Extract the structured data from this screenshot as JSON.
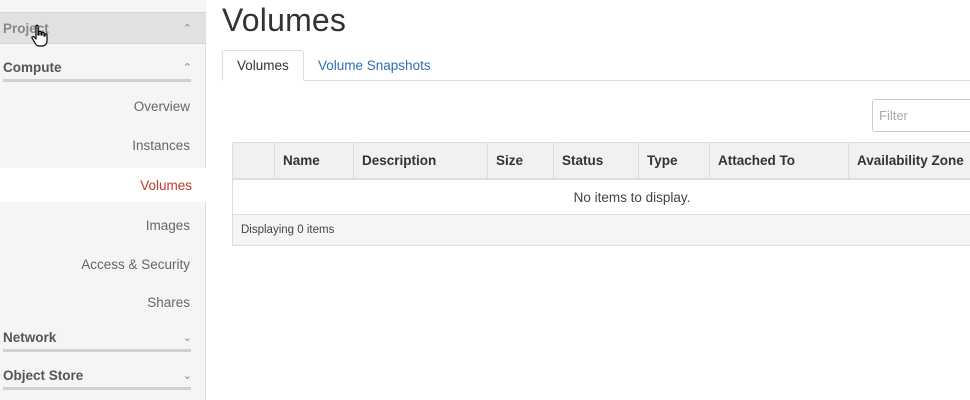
{
  "sidebar": {
    "project": {
      "label": "Project"
    },
    "compute": {
      "label": "Compute",
      "items": [
        {
          "label": "Overview"
        },
        {
          "label": "Instances"
        },
        {
          "label": "Volumes"
        },
        {
          "label": "Images"
        },
        {
          "label": "Access & Security"
        },
        {
          "label": "Shares"
        }
      ]
    },
    "network": {
      "label": "Network"
    },
    "object_store": {
      "label": "Object Store"
    }
  },
  "main": {
    "title": "Volumes",
    "tabs": [
      {
        "label": "Volumes"
      },
      {
        "label": "Volume Snapshots"
      }
    ],
    "filter": {
      "placeholder": "Filter"
    },
    "table": {
      "columns": [
        "Name",
        "Description",
        "Size",
        "Status",
        "Type",
        "Attached To",
        "Availability Zone"
      ],
      "empty_message": "No items to display.",
      "footer": "Displaying 0 items"
    }
  },
  "colors": {
    "active_nav": "#c0392b",
    "link": "#2d6fb3"
  },
  "icons": {
    "expanded": "chevron-up-icon",
    "collapsed": "chevron-down-icon",
    "cursor": "hand-pointer-icon"
  }
}
